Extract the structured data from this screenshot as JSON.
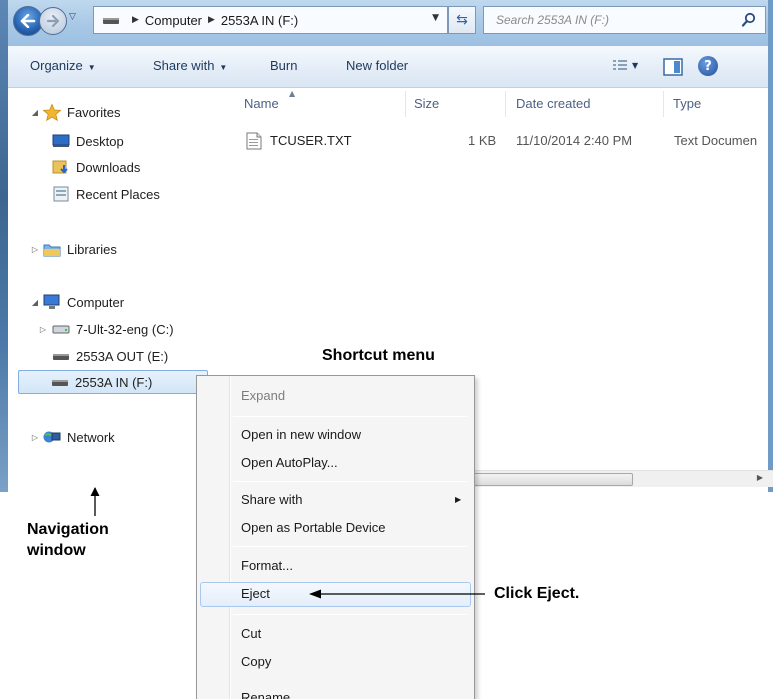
{
  "address_bar": {
    "crumbs": [
      "Computer",
      "2553A IN (F:)"
    ],
    "search_placeholder": "Search 2553A IN (F:)"
  },
  "toolbar": {
    "organize": "Organize",
    "share_with": "Share with",
    "burn": "Burn",
    "new_folder": "New folder"
  },
  "nav_pane": {
    "favorites": "Favorites",
    "desktop": "Desktop",
    "downloads": "Downloads",
    "recent_places": "Recent Places",
    "libraries": "Libraries",
    "computer": "Computer",
    "drive_c": "7-Ult-32-eng (C:)",
    "drive_e": "2553A OUT (E:)",
    "drive_f": "2553A IN (F:)",
    "network": "Network"
  },
  "file_list": {
    "columns": [
      "Name",
      "Size",
      "Date created",
      "Type"
    ],
    "rows": [
      {
        "name": "TCUSER.TXT",
        "size": "1 KB",
        "date_created": "11/10/2014 2:40 PM",
        "type": "Text Documen"
      }
    ]
  },
  "context_menu": {
    "expand": "Expand",
    "open_new_window": "Open in new window",
    "open_autoplay": "Open AutoPlay...",
    "share_with": "Share with",
    "open_portable": "Open as Portable Device",
    "format": "Format...",
    "eject": "Eject",
    "cut": "Cut",
    "copy": "Copy",
    "rename": "Rename"
  },
  "callouts": {
    "shortcut_menu": "Shortcut menu",
    "navigation_window_line1": "Navigation",
    "navigation_window_line2": "window",
    "click_eject": "Click Eject."
  },
  "icons": {
    "back": "back-arrow-icon",
    "forward": "forward-arrow-icon",
    "search": "search-icon",
    "favorites": "star-icon",
    "folder": "folder-icon",
    "drive": "drive-icon",
    "computer": "computer-icon",
    "network": "network-icon",
    "file": "text-file-icon"
  },
  "colors": {
    "title_gradient_top": "#bfd8ee",
    "selection_border": "#84acdd",
    "menu_highlight_border": "#a8c8ef"
  }
}
